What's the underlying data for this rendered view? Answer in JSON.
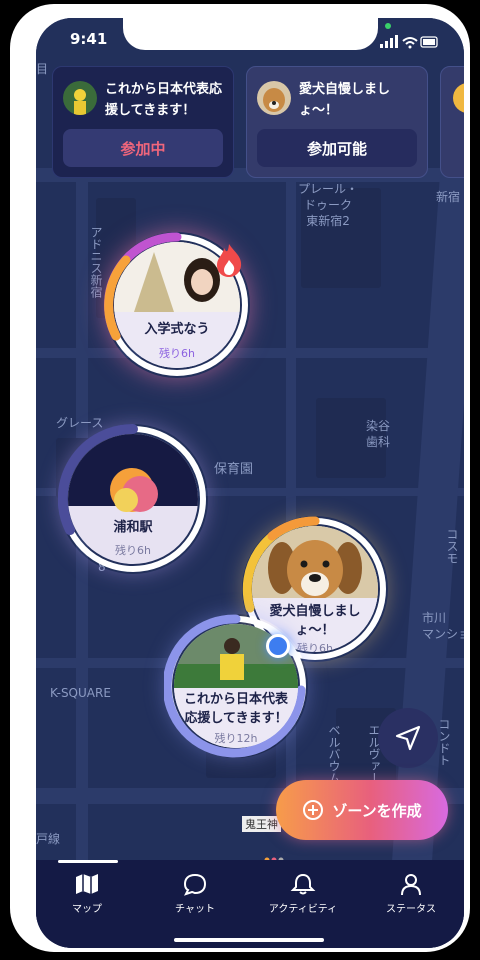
{
  "status_bar": {
    "time": "9:41"
  },
  "cards": [
    {
      "title": "これから日本代表応援してきます！",
      "button": "参加中",
      "state": "joined"
    },
    {
      "title": "愛犬自慢しましょ〜！",
      "button": "参加可能",
      "state": "open"
    }
  ],
  "map_labels": {
    "purele": "プレール・\nドゥーク\n東新宿2",
    "adonis": "アドニス新宿",
    "grace": "グレース",
    "hoikuen": "保育園",
    "somegaya": "染谷\n歯科",
    "k_square": "K-SQUARE",
    "kosumo": "コスモ",
    "ichikawa": "市川\nマンション",
    "beruvaum": "ベルバウム",
    "eruvaru": "エルヴァール",
    "kotto": "コンドト",
    "oni": "鬼王神",
    "line": "戸線",
    "me": "目",
    "shinjuku": "新宿",
    "eight": "8"
  },
  "zones": [
    {
      "id": "nyugaku",
      "title": "入学式なう",
      "left": "残り6h",
      "hot": true
    },
    {
      "id": "urawa",
      "title": "浦和駅",
      "left": "残り6h"
    },
    {
      "id": "dog",
      "title": "愛犬自慢しましょ〜！",
      "left": "残り6h"
    },
    {
      "id": "soccer",
      "title": "これから日本代表応援してきます！",
      "left": "残り12h"
    }
  ],
  "fab": {
    "label": "ゾーンを作成"
  },
  "tabs": [
    {
      "label": "マップ",
      "active": true
    },
    {
      "label": "チャット"
    },
    {
      "label": "アクティビティ"
    },
    {
      "label": "ステータス"
    }
  ],
  "colors": {
    "accent": "#f0667c",
    "map_bg": "#22305b",
    "tab_bg": "#141a45"
  },
  "icons": {
    "location": "send-arrow-icon",
    "fab": "plus-circle-icon"
  }
}
